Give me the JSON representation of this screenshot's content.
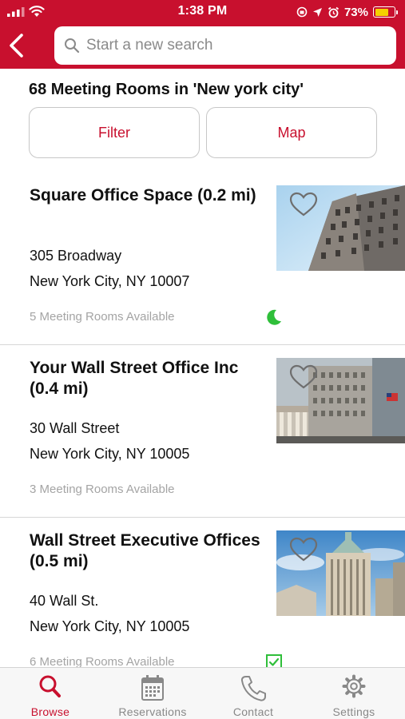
{
  "status_bar": {
    "time": "1:38 PM",
    "battery_percent": "73%",
    "battery_level": 0.73
  },
  "search": {
    "placeholder": "Start a new search"
  },
  "results": {
    "heading": "68 Meeting Rooms in 'New york city'",
    "filter_label": "Filter",
    "map_label": "Map"
  },
  "listings": [
    {
      "title": "Square Office Space (0.2 mi)",
      "street": "305 Broadway",
      "city": "New York City, NY 10007",
      "availability": "5 Meeting Rooms Available",
      "status_icon": "moon-icon",
      "favorite_icon": "heart-icon"
    },
    {
      "title": "Your Wall Street Office Inc (0.4 mi)",
      "street": "30 Wall Street",
      "city": "New York City, NY 10005",
      "availability": "3 Meeting Rooms Available",
      "favorite_icon": "heart-icon"
    },
    {
      "title": "Wall Street Executive Offices (0.5 mi)",
      "street": "40 Wall St.",
      "city": "New York City, NY 10005",
      "availability": "6 Meeting Rooms Available",
      "status_icon": "checkbox-icon",
      "favorite_icon": "heart-icon"
    }
  ],
  "tabbar": {
    "tabs": [
      {
        "label": "Browse",
        "icon": "search-icon",
        "active": true
      },
      {
        "label": "Reservations",
        "icon": "calendar-icon",
        "active": false
      },
      {
        "label": "Contact",
        "icon": "phone-icon",
        "active": false
      },
      {
        "label": "Settings",
        "icon": "gear-icon",
        "active": false
      }
    ]
  },
  "colors": {
    "brand_red": "#c8102e",
    "status_green": "#2fbf3a",
    "battery_yellow": "#f5d000",
    "muted_text": "#a4a4a4"
  }
}
